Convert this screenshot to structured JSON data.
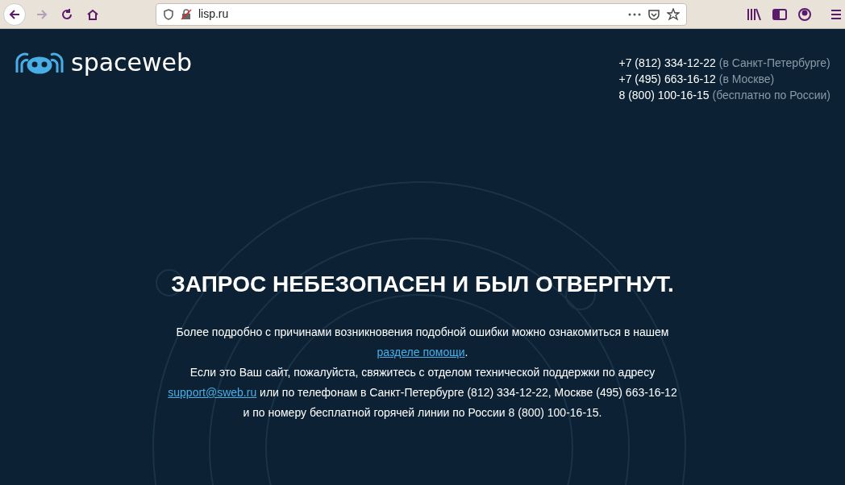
{
  "browser": {
    "url": "lisp.ru",
    "forward_disabled": true
  },
  "logo": {
    "text": "spaceweb"
  },
  "phones": [
    {
      "number": "+7 (812) 334-12-22",
      "note": "(в Санкт-Петербурге)"
    },
    {
      "number": "+7 (495) 663-16-12",
      "note": "(в Москве)"
    },
    {
      "number": "8 (800) 100-16-15",
      "note": "(бесплатно по России)"
    }
  ],
  "heading": "ЗАПРОС НЕБЕЗОПАСЕН И БЫЛ ОТВЕРГНУТ.",
  "paragraphs": [
    {
      "before": "Более подробно с причинами возникновения подобной ошибки можно ознакомиться в нашем ",
      "link": "разделе помощи",
      "after": "."
    },
    {
      "before": "Если это Ваш сайт, пожалуйста, свяжитесь с отделом технической поддержки по адресу ",
      "link": "support@sweb.ru",
      "after": " или по телефонам в Санкт-Петербурге (812) 334-12-22, Москве (495) 663-16-12 и по номеру бесплатной горячей линии по России 8 (800) 100-16-15."
    }
  ]
}
